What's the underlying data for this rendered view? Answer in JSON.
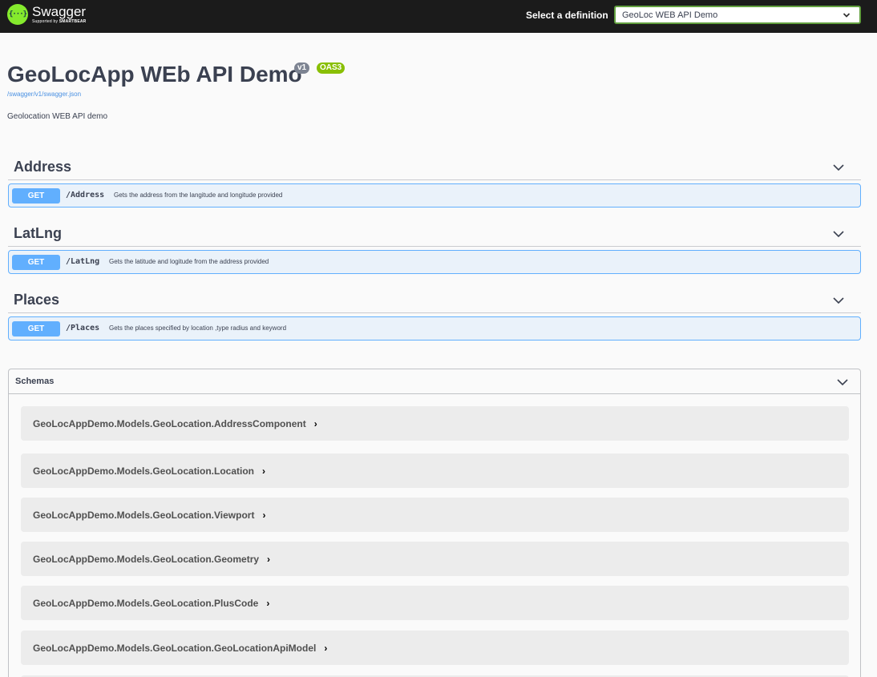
{
  "topbar": {
    "logo_icon": "swagger-braces-icon",
    "logo_glyph": "{···}",
    "logo_name": "Swagger",
    "logo_sub_prefix": "Supported by",
    "logo_sub_brand": "SMARTBEAR",
    "definition_label": "Select a definition",
    "definition_value": "GeoLoc WEB API Demo",
    "colors": {
      "bar": "#1b1b1b",
      "logo": "#85ea2d",
      "select_border": "#62a03f"
    }
  },
  "info": {
    "title": "GeoLocApp WEb API Demo",
    "version_badge": "v1",
    "oas_badge": "OAS3",
    "spec_url": "/swagger/v1/swagger.json",
    "description": "Geolocation WEB API demo"
  },
  "tags": [
    {
      "name": "Address",
      "method": "GET",
      "path": "/Address",
      "summary": "Gets the address from the langitude and longitude provided"
    },
    {
      "name": "LatLng",
      "method": "GET",
      "path": "/LatLng",
      "summary": "Gets the latitude and logitude from the address provided"
    },
    {
      "name": "Places",
      "method": "GET",
      "path": "/Places",
      "summary": "Gets the places specified by location ,type radius and keyword"
    }
  ],
  "schemas": {
    "title": "Schemas",
    "models": [
      "GeoLocAppDemo.Models.GeoLocation.AddressComponent",
      "GeoLocAppDemo.Models.GeoLocation.Location",
      "GeoLocAppDemo.Models.GeoLocation.Viewport",
      "GeoLocAppDemo.Models.GeoLocation.Geometry",
      "GeoLocAppDemo.Models.GeoLocation.PlusCode",
      "GeoLocAppDemo.Models.GeoLocation.GeoLocationApiModel"
    ]
  },
  "colors": {
    "get_method": "#61affe",
    "version_badge": "#7d8492",
    "oas_badge": "#89bf04",
    "link": "#4990e2"
  }
}
